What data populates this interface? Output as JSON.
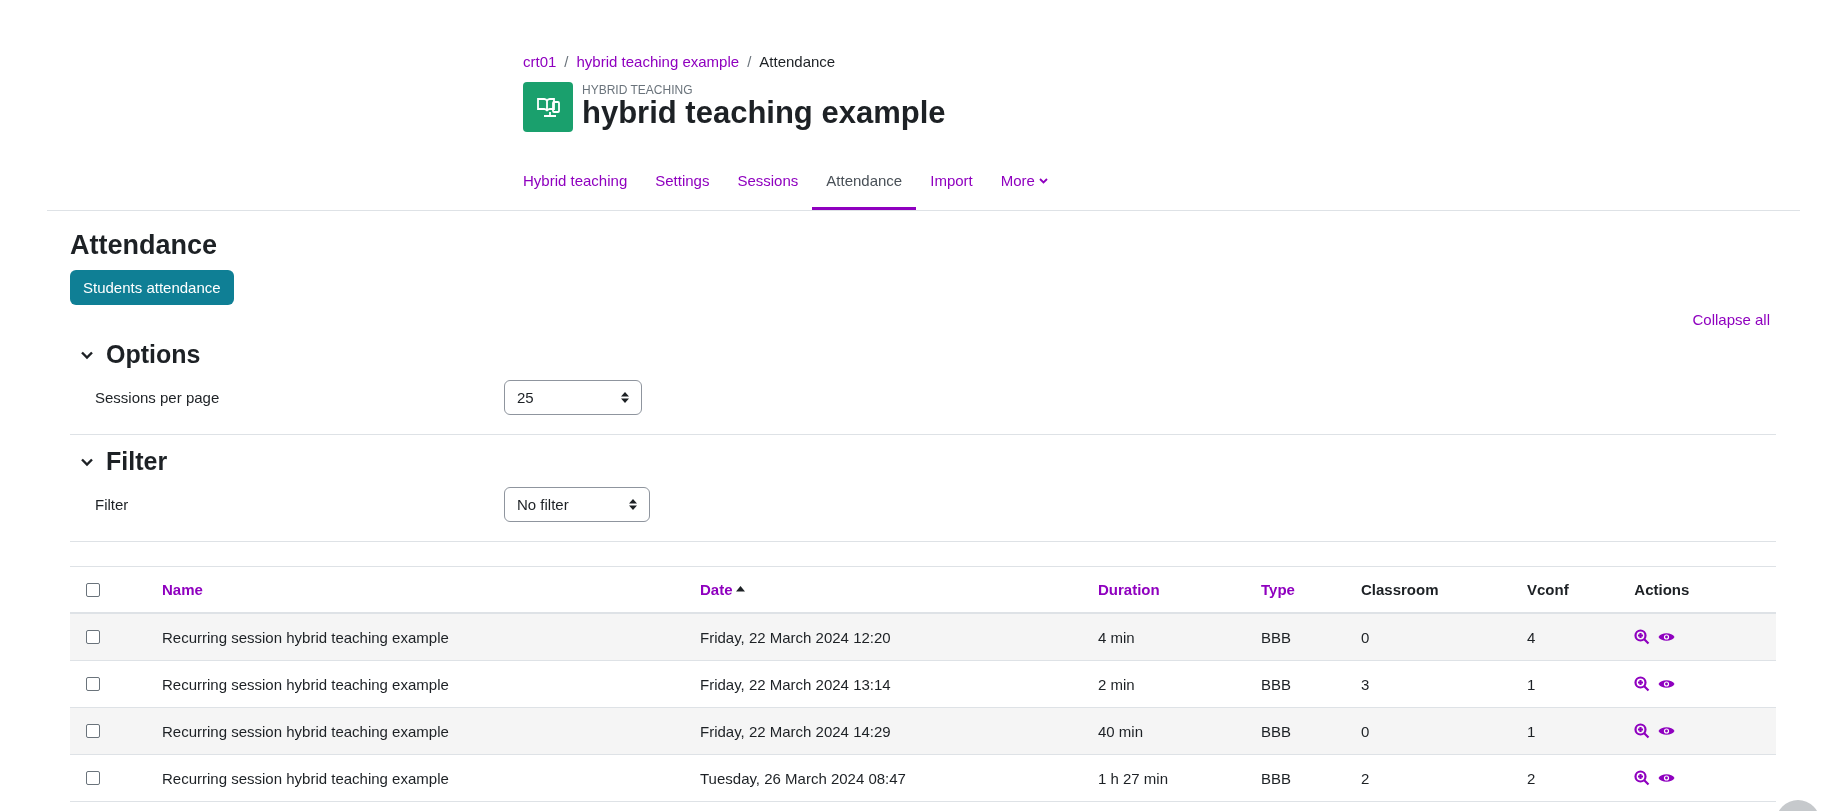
{
  "breadcrumb": [
    {
      "label": "crt01",
      "link": true
    },
    {
      "separator_before": "/",
      "label": "hybrid teaching example",
      "link": true
    },
    {
      "separator_before": "/",
      "label": "Attendance",
      "link": false
    }
  ],
  "header": {
    "module_type": "HYBRID TEACHING",
    "title": "hybrid teaching example"
  },
  "tabs": [
    {
      "label": "Hybrid teaching",
      "selected": false,
      "has_menu": false
    },
    {
      "label": "Settings",
      "selected": false,
      "has_menu": false
    },
    {
      "label": "Sessions",
      "selected": false,
      "has_menu": false
    },
    {
      "label": "Attendance",
      "selected": true,
      "has_menu": false
    },
    {
      "label": "Import",
      "selected": false,
      "has_menu": false
    },
    {
      "label": "More",
      "selected": false,
      "has_menu": true
    }
  ],
  "page_title": "Attendance",
  "primary_button": "Students attendance",
  "collapse_link": "Collapse all",
  "sections": [
    {
      "title": "Options",
      "expanded": true,
      "field_label": "Sessions per page",
      "value": "25"
    },
    {
      "title": "Filter",
      "expanded": true,
      "field_label": "Filter",
      "value": "No filter"
    }
  ],
  "table": {
    "select_all_checked": false,
    "columns": [
      {
        "label": "Name",
        "link": true
      },
      {
        "label": "Date",
        "link": true,
        "sorted": true
      },
      {
        "label": "Duration",
        "link": true
      },
      {
        "label": "Type",
        "link": true
      },
      {
        "label": "Classroom",
        "link": false
      },
      {
        "label": "Vconf",
        "link": false
      },
      {
        "label": "Actions",
        "link": false
      }
    ],
    "rows": [
      {
        "checked": false,
        "cells": [
          "Recurring session hybrid teaching example",
          "Friday, 22 March 2024 12:20",
          "4 min",
          "BBB",
          "0",
          "4"
        ]
      },
      {
        "checked": false,
        "cells": [
          "Recurring session hybrid teaching example",
          "Friday, 22 March 2024 13:14",
          "2 min",
          "BBB",
          "3",
          "1"
        ]
      },
      {
        "checked": false,
        "cells": [
          "Recurring session hybrid teaching example",
          "Friday, 22 March 2024 14:29",
          "40 min",
          "BBB",
          "0",
          "1"
        ]
      },
      {
        "checked": false,
        "cells": [
          "Recurring session hybrid teaching example",
          "Tuesday, 26 March 2024 08:47",
          "1 h 27 min",
          "BBB",
          "2",
          "2"
        ]
      }
    ]
  }
}
